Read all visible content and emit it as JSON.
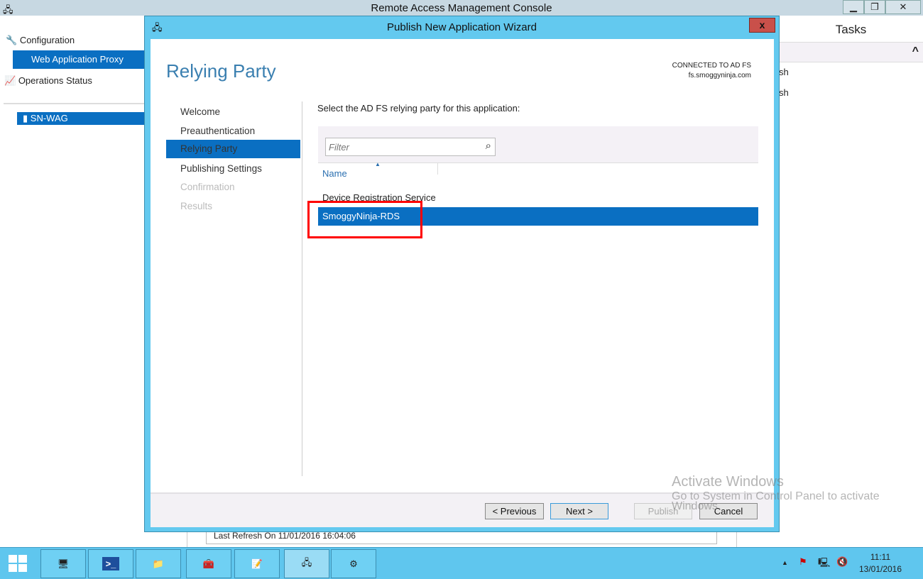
{
  "console": {
    "title": "Remote Access Management Console",
    "min": "▁",
    "restore": "❐",
    "close": "✕",
    "tree": {
      "configuration": "Configuration",
      "web_application_proxy": "Web Application Proxy",
      "operations_status": "Operations Status",
      "server": "SN-WAG"
    },
    "tasks_title": "Tasks",
    "tasks_items": [
      "sh",
      "sh"
    ],
    "collapse": "^",
    "last_refresh": "Last Refresh On 11/01/2016 16:04:06"
  },
  "wizard": {
    "title": "Publish New Application Wizard",
    "close": "x",
    "page_title": "Relying Party",
    "connected_label": "CONNECTED TO AD FS",
    "connected_server": "fs.smoggyninja.com",
    "steps": [
      {
        "label": "Welcome",
        "state": "done"
      },
      {
        "label": "Preauthentication",
        "state": "done"
      },
      {
        "label": "Relying Party",
        "state": "current"
      },
      {
        "label": "Publishing Settings",
        "state": "pending"
      },
      {
        "label": "Confirmation",
        "state": "disabled"
      },
      {
        "label": "Results",
        "state": "disabled"
      }
    ],
    "instruction": "Select the AD FS relying party for this application:",
    "filter_placeholder": "Filter",
    "column_name": "Name",
    "rows": [
      "Device Registration Service",
      "SmoggyNinja-RDS"
    ],
    "buttons": {
      "previous": "< Previous",
      "next": "Next >",
      "publish": "Publish",
      "cancel": "Cancel"
    }
  },
  "watermark": {
    "line1": "Activate Windows",
    "line2": "Go to System in Control Panel to activate",
    "line3": "Windows."
  },
  "taskbar": {
    "time": "11:11",
    "date": "13/01/2016",
    "tray_arrow": "▲"
  },
  "colors": {
    "accent": "#63c9ef",
    "selection": "#0a6fc2",
    "highlight_box": "#ff0000"
  }
}
